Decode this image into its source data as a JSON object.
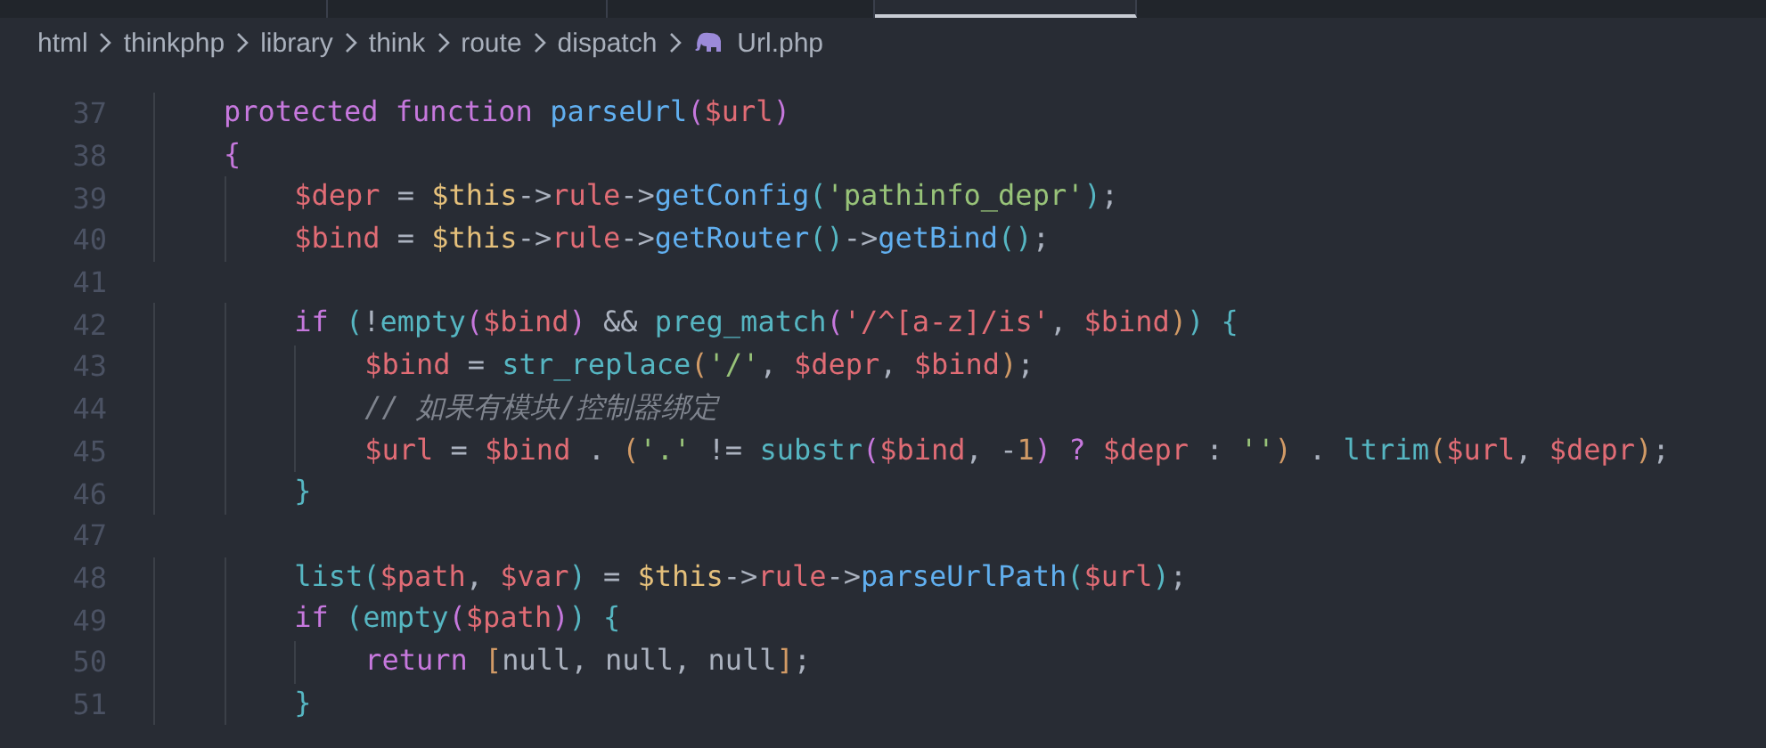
{
  "breadcrumb": [
    {
      "label": "html",
      "kind": "folder"
    },
    {
      "label": "thinkphp",
      "kind": "folder"
    },
    {
      "label": "library",
      "kind": "folder"
    },
    {
      "label": "think",
      "kind": "folder"
    },
    {
      "label": "route",
      "kind": "folder"
    },
    {
      "label": "dispatch",
      "kind": "folder"
    },
    {
      "label": "Url.php",
      "kind": "file"
    }
  ],
  "code_lines": [
    {
      "number": "37",
      "tokens": [
        {
          "text": "    protected",
          "kind": "keyword"
        },
        {
          "text": " function",
          "kind": "keyword"
        },
        {
          "text": " parseUrl",
          "kind": "function"
        },
        {
          "text": "(",
          "kind": "bracket2"
        },
        {
          "text": "$url",
          "kind": "variable"
        },
        {
          "text": ")",
          "kind": "bracket2"
        }
      ]
    },
    {
      "number": "38",
      "tokens": [
        {
          "text": "    {",
          "kind": "bracket2"
        }
      ]
    },
    {
      "number": "39",
      "tokens": [
        {
          "text": "        $depr",
          "kind": "variable"
        },
        {
          "text": " = ",
          "kind": "plain"
        },
        {
          "text": "$this",
          "kind": "this"
        },
        {
          "text": "->",
          "kind": "plain"
        },
        {
          "text": "rule",
          "kind": "variable"
        },
        {
          "text": "->",
          "kind": "plain"
        },
        {
          "text": "getConfig",
          "kind": "function"
        },
        {
          "text": "(",
          "kind": "bracket3"
        },
        {
          "text": "'pathinfo_depr'",
          "kind": "string"
        },
        {
          "text": ")",
          "kind": "bracket3"
        },
        {
          "text": ";",
          "kind": "plain"
        }
      ]
    },
    {
      "number": "40",
      "tokens": [
        {
          "text": "        $bind",
          "kind": "variable"
        },
        {
          "text": " = ",
          "kind": "plain"
        },
        {
          "text": "$this",
          "kind": "this"
        },
        {
          "text": "->",
          "kind": "plain"
        },
        {
          "text": "rule",
          "kind": "variable"
        },
        {
          "text": "->",
          "kind": "plain"
        },
        {
          "text": "getRouter",
          "kind": "function"
        },
        {
          "text": "()",
          "kind": "bracket3"
        },
        {
          "text": "->",
          "kind": "plain"
        },
        {
          "text": "getBind",
          "kind": "function"
        },
        {
          "text": "()",
          "kind": "bracket3"
        },
        {
          "text": ";",
          "kind": "plain"
        }
      ]
    },
    {
      "number": "41"
    },
    {
      "number": "42",
      "tokens": [
        {
          "text": "        if",
          "kind": "keyword"
        },
        {
          "text": " (",
          "kind": "bracket3"
        },
        {
          "text": "!",
          "kind": "plain"
        },
        {
          "text": "empty",
          "kind": "builtin"
        },
        {
          "text": "(",
          "kind": "bracket2"
        },
        {
          "text": "$bind",
          "kind": "variable"
        },
        {
          "text": ")",
          "kind": "bracket2"
        },
        {
          "text": " && ",
          "kind": "plain"
        },
        {
          "text": "preg_match",
          "kind": "builtin"
        },
        {
          "text": "(",
          "kind": "bracket2"
        },
        {
          "text": "'/^[a-z]/is'",
          "kind": "regex"
        },
        {
          "text": ", ",
          "kind": "plain"
        },
        {
          "text": "$bind",
          "kind": "variable"
        },
        {
          "text": ")",
          "kind": "bracket1"
        },
        {
          "text": ")",
          "kind": "bracket3"
        },
        {
          "text": " {",
          "kind": "bracket3"
        }
      ]
    },
    {
      "number": "43",
      "tokens": [
        {
          "text": "            $bind",
          "kind": "variable"
        },
        {
          "text": " = ",
          "kind": "plain"
        },
        {
          "text": "str_replace",
          "kind": "builtin"
        },
        {
          "text": "(",
          "kind": "bracket1"
        },
        {
          "text": "'/'",
          "kind": "string"
        },
        {
          "text": ", ",
          "kind": "plain"
        },
        {
          "text": "$depr",
          "kind": "variable"
        },
        {
          "text": ", ",
          "kind": "plain"
        },
        {
          "text": "$bind",
          "kind": "variable"
        },
        {
          "text": ")",
          "kind": "bracket1"
        },
        {
          "text": ";",
          "kind": "plain"
        }
      ]
    },
    {
      "number": "44",
      "tokens": [
        {
          "text": "            // 如果有模块/控制器绑定",
          "kind": "comment"
        }
      ]
    },
    {
      "number": "45",
      "tokens": [
        {
          "text": "            $url",
          "kind": "variable"
        },
        {
          "text": " = ",
          "kind": "plain"
        },
        {
          "text": "$bind",
          "kind": "variable"
        },
        {
          "text": " . ",
          "kind": "plain"
        },
        {
          "text": "(",
          "kind": "bracket1"
        },
        {
          "text": "'.'",
          "kind": "string"
        },
        {
          "text": " != ",
          "kind": "plain"
        },
        {
          "text": "substr",
          "kind": "builtin"
        },
        {
          "text": "(",
          "kind": "bracket2"
        },
        {
          "text": "$bind",
          "kind": "variable"
        },
        {
          "text": ", -",
          "kind": "plain"
        },
        {
          "text": "1",
          "kind": "number"
        },
        {
          "text": ")",
          "kind": "bracket2"
        },
        {
          "text": " ? ",
          "kind": "keyword"
        },
        {
          "text": "$depr",
          "kind": "variable"
        },
        {
          "text": " : ",
          "kind": "plain"
        },
        {
          "text": "''",
          "kind": "string"
        },
        {
          "text": ")",
          "kind": "bracket1"
        },
        {
          "text": " . ",
          "kind": "plain"
        },
        {
          "text": "ltrim",
          "kind": "builtin"
        },
        {
          "text": "(",
          "kind": "bracket1"
        },
        {
          "text": "$url",
          "kind": "variable"
        },
        {
          "text": ", ",
          "kind": "plain"
        },
        {
          "text": "$depr",
          "kind": "variable"
        },
        {
          "text": ")",
          "kind": "bracket1"
        },
        {
          "text": ";",
          "kind": "plain"
        }
      ]
    },
    {
      "number": "46",
      "tokens": [
        {
          "text": "        }",
          "kind": "bracket3"
        }
      ]
    },
    {
      "number": "47"
    },
    {
      "number": "48",
      "tokens": [
        {
          "text": "        list",
          "kind": "builtin"
        },
        {
          "text": "(",
          "kind": "bracket3"
        },
        {
          "text": "$path",
          "kind": "variable"
        },
        {
          "text": ", ",
          "kind": "plain"
        },
        {
          "text": "$var",
          "kind": "variable"
        },
        {
          "text": ")",
          "kind": "bracket3"
        },
        {
          "text": " = ",
          "kind": "plain"
        },
        {
          "text": "$this",
          "kind": "this"
        },
        {
          "text": "->",
          "kind": "plain"
        },
        {
          "text": "rule",
          "kind": "variable"
        },
        {
          "text": "->",
          "kind": "plain"
        },
        {
          "text": "parseUrlPath",
          "kind": "function"
        },
        {
          "text": "(",
          "kind": "bracket3"
        },
        {
          "text": "$url",
          "kind": "variable"
        },
        {
          "text": ")",
          "kind": "bracket3"
        },
        {
          "text": ";",
          "kind": "plain"
        }
      ]
    },
    {
      "number": "49",
      "tokens": [
        {
          "text": "        if",
          "kind": "keyword"
        },
        {
          "text": " (",
          "kind": "bracket3"
        },
        {
          "text": "empty",
          "kind": "builtin"
        },
        {
          "text": "(",
          "kind": "bracket2"
        },
        {
          "text": "$path",
          "kind": "variable"
        },
        {
          "text": ")",
          "kind": "bracket2"
        },
        {
          "text": ")",
          "kind": "bracket3"
        },
        {
          "text": " {",
          "kind": "bracket3"
        }
      ]
    },
    {
      "number": "50",
      "tokens": [
        {
          "text": "            return",
          "kind": "keyword"
        },
        {
          "text": " [",
          "kind": "bracket1"
        },
        {
          "text": "null, null, null",
          "kind": "plain"
        },
        {
          "text": "]",
          "kind": "bracket1"
        },
        {
          "text": ";",
          "kind": "plain"
        }
      ]
    },
    {
      "number": "51",
      "tokens": [
        {
          "text": "        }",
          "kind": "bracket3"
        }
      ]
    }
  ]
}
